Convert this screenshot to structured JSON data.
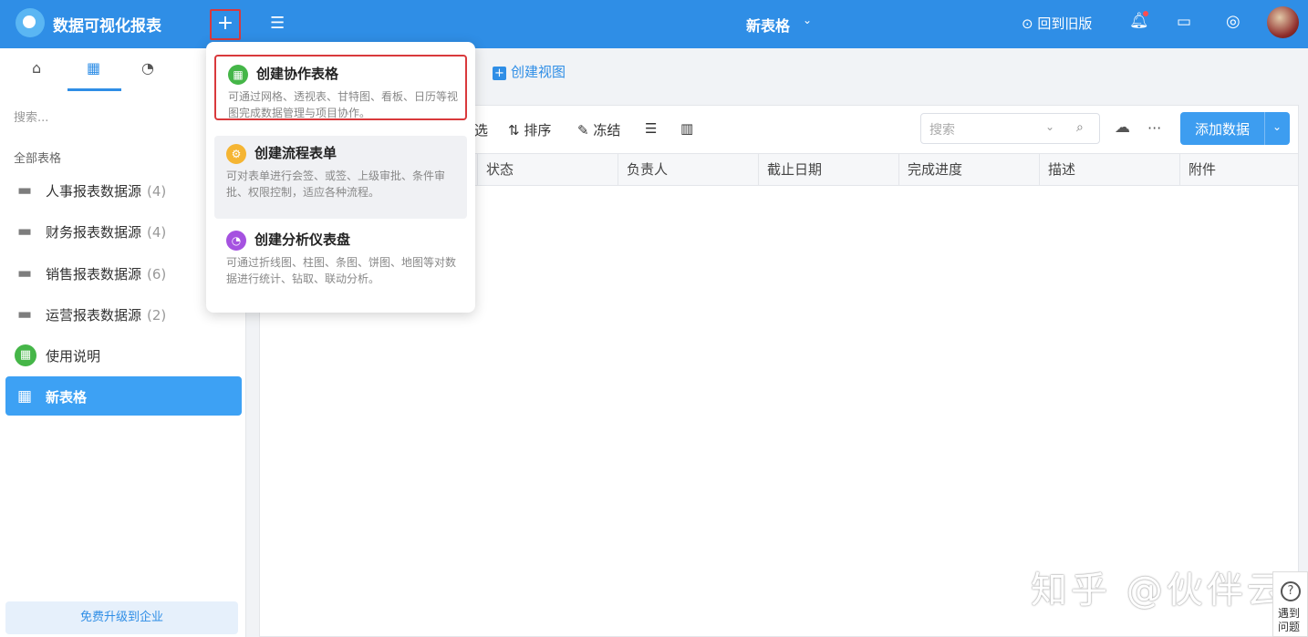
{
  "header": {
    "app_title": "数据可视化报表",
    "doc_title": "新表格",
    "back_link": "回到旧版"
  },
  "sidebar": {
    "search_placeholder": "搜索...",
    "section_label": "全部表格",
    "items": [
      {
        "label": "人事报表数据源",
        "count": "(4)",
        "icon": "folder-icon"
      },
      {
        "label": "财务报表数据源",
        "count": "(4)",
        "icon": "folder-icon"
      },
      {
        "label": "销售报表数据源",
        "count": "(6)",
        "icon": "folder-icon"
      },
      {
        "label": "运营报表数据源",
        "count": "(2)",
        "icon": "folder-icon"
      },
      {
        "label": "使用说明",
        "icon": "grid-icon"
      },
      {
        "label": "新表格",
        "icon": "grid-icon",
        "active": true
      }
    ],
    "upgrade": "免费升级到企业"
  },
  "toolbar": {
    "create_view": "创建视图",
    "filter_partial": "选",
    "sort": "排序",
    "freeze": "冻结",
    "search_placeholder": "搜索",
    "add_data": "添加数据"
  },
  "table": {
    "columns": [
      "状态",
      "负责人",
      "截止日期",
      "完成进度",
      "描述",
      "附件"
    ]
  },
  "popup": {
    "options": [
      {
        "title": "创建协作表格",
        "desc": "可通过网格、透视表、甘特图、看板、日历等视图完成数据管理与项目协作。",
        "color": "#45b648"
      },
      {
        "title": "创建流程表单",
        "desc": "可对表单进行会签、或签、上级审批、条件审批、权限控制，适应各种流程。",
        "color": "#f5b533"
      },
      {
        "title": "创建分析仪表盘",
        "desc": "可通过折线图、柱图、条图、饼图、地图等对数据进行统计、钻取、联动分析。",
        "color": "#a552e0"
      }
    ]
  },
  "watermark": "知乎 @伙伴云",
  "help": {
    "label": "遇到问题"
  }
}
